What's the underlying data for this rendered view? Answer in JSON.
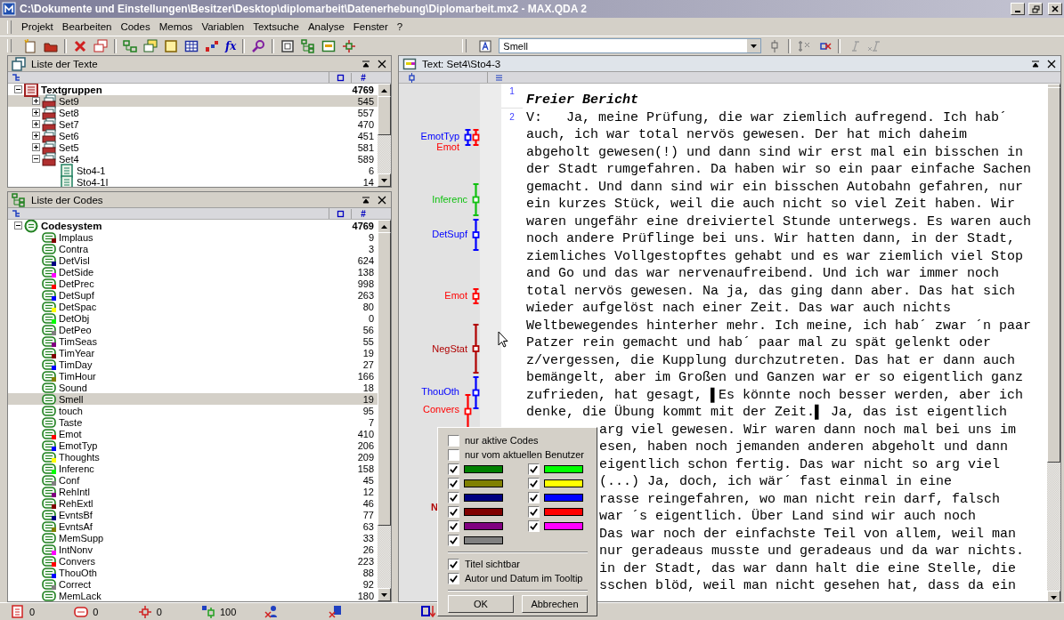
{
  "window": {
    "title": "C:\\Dokumente und Einstellungen\\Besitzer\\Desktop\\diplomarbeit\\Datenerhebung\\Diplomarbeit.mx2 - MAX.QDA 2"
  },
  "menu": [
    "Projekt",
    "Bearbeiten",
    "Codes",
    "Memos",
    "Variablen",
    "Textsuche",
    "Analyse",
    "Fenster",
    "?"
  ],
  "toolbar": {
    "function_button": "fx",
    "code_select": {
      "value": "Smell"
    }
  },
  "texts_panel": {
    "title": "Liste der Texte",
    "count_column": "#",
    "tree": {
      "label": "Textgruppen",
      "count": "4769",
      "expanded": true,
      "selected": false,
      "children": [
        {
          "label": "Set9",
          "count": "545",
          "expanded": false,
          "selected": true
        },
        {
          "label": "Set8",
          "count": "557",
          "expanded": false,
          "selected": false
        },
        {
          "label": "Set7",
          "count": "470",
          "expanded": false,
          "selected": false
        },
        {
          "label": "Set6",
          "count": "451",
          "expanded": false,
          "selected": false
        },
        {
          "label": "Set5",
          "count": "581",
          "expanded": false,
          "selected": false
        },
        {
          "label": "Set4",
          "count": "589",
          "expanded": true,
          "selected": false,
          "children": [
            {
              "label": "Sto4-1",
              "count": "6",
              "selected": false
            },
            {
              "label": "Sto4-1I",
              "count": "14",
              "selected": false
            }
          ]
        }
      ]
    }
  },
  "codes_panel": {
    "title": "Liste der Codes",
    "count_column": "#",
    "tree": {
      "label": "Codesystem",
      "count": "4769",
      "expanded": true,
      "selected": false,
      "children": [
        {
          "label": "Implaus",
          "count": "9",
          "color": "#800000",
          "selected": false
        },
        {
          "label": "Contra",
          "count": "3",
          "selected": false
        },
        {
          "label": "DetVisl",
          "count": "624",
          "color": "#000080",
          "selected": false
        },
        {
          "label": "DetSide",
          "count": "138",
          "color": "#ff00ff",
          "selected": false
        },
        {
          "label": "DetPrec",
          "count": "998",
          "color": "#ff0000",
          "selected": false
        },
        {
          "label": "DetSupf",
          "count": "263",
          "color": "#0000ff",
          "selected": false
        },
        {
          "label": "DetSpac",
          "count": "80",
          "color": "#ffff00",
          "selected": false
        },
        {
          "label": "DetObj",
          "count": "0",
          "color": "#00ff00",
          "selected": false
        },
        {
          "label": "DetPeo",
          "count": "56",
          "color": "#808080",
          "selected": false
        },
        {
          "label": "TimSeas",
          "count": "55",
          "color": "#800080",
          "selected": false
        },
        {
          "label": "TimYear",
          "count": "19",
          "color": "#800000",
          "selected": false
        },
        {
          "label": "TimDay",
          "count": "27",
          "color": "#0000ff",
          "selected": false
        },
        {
          "label": "TimHour",
          "count": "166",
          "color": "#808000",
          "selected": false
        },
        {
          "label": "Sound",
          "count": "18",
          "selected": false
        },
        {
          "label": "Smell",
          "count": "19",
          "selected": true
        },
        {
          "label": "touch",
          "count": "95",
          "selected": false
        },
        {
          "label": "Taste",
          "count": "7",
          "selected": false
        },
        {
          "label": "Emot",
          "count": "410",
          "color": "#ff0000",
          "selected": false
        },
        {
          "label": "EmotTyp",
          "count": "206",
          "color": "#0000ff",
          "selected": false
        },
        {
          "label": "Thoughts",
          "count": "209",
          "color": "#ffff00",
          "selected": false
        },
        {
          "label": "Inferenc",
          "count": "158",
          "color": "#00ff00",
          "selected": false
        },
        {
          "label": "Conf",
          "count": "45",
          "color": "#808080",
          "selected": false
        },
        {
          "label": "RehIntl",
          "count": "12",
          "color": "#800080",
          "selected": false
        },
        {
          "label": "RehExtl",
          "count": "46",
          "color": "#800000",
          "selected": false
        },
        {
          "label": "EvntsBf",
          "count": "77",
          "color": "#000080",
          "selected": false
        },
        {
          "label": "EvntsAf",
          "count": "63",
          "color": "#808000",
          "selected": false
        },
        {
          "label": "MemSupp",
          "count": "33",
          "selected": false
        },
        {
          "label": "IntNonv",
          "count": "26",
          "color": "#ff00ff",
          "selected": false
        },
        {
          "label": "Convers",
          "count": "223",
          "color": "#ff0000",
          "selected": false
        },
        {
          "label": "ThouOth",
          "count": "88",
          "color": "#0000ff",
          "selected": false
        },
        {
          "label": "Correct",
          "count": "92",
          "color": "#808080",
          "selected": false
        },
        {
          "label": "MemLack",
          "count": "180",
          "selected": false
        }
      ]
    }
  },
  "status_bar": {
    "counts": [
      "0",
      "0",
      "0",
      "100"
    ]
  },
  "text_window": {
    "title": "Text: Set4\\Sto4-3",
    "margin_codes": [
      {
        "label": "EmotTyp",
        "color": "#0000ff"
      },
      {
        "label": "Emot",
        "color": "#ff0000"
      },
      {
        "label": "Inferenc",
        "color": "#10c010"
      },
      {
        "label": "DetSupf",
        "color": "#0000ff"
      },
      {
        "label": "Emot",
        "color": "#ff0000"
      },
      {
        "label": "NegStat",
        "color": "#b00000"
      },
      {
        "label": "ThouOth",
        "color": "#0000ff"
      },
      {
        "label": "Convers",
        "color": "#ff0000"
      },
      {
        "label": "N",
        "color": "#b00000"
      }
    ],
    "paragraphs": [
      {
        "number": "1",
        "kind": "title",
        "lines": [
          {
            "text": "Freier Bericht",
            "kind": "full"
          }
        ]
      },
      {
        "number": "2",
        "kind": "body",
        "lines": [
          {
            "text": "V:   Ja, meine Prüfung, die war ziemlich aufregend. Ich hab´",
            "kind": "full"
          },
          {
            "text": "auch, ich war total nervös gewesen. Der hat mich daheim",
            "kind": "full"
          },
          {
            "text": "abgeholt gewesen(!) und dann sind wir erst mal ein bisschen in",
            "kind": "full"
          },
          {
            "text": "der Stadt rumgefahren. Da haben wir so ein paar einfache Sachen",
            "kind": "full"
          },
          {
            "text": "gemacht. Und dann sind wir ein bisschen Autobahn gefahren, nur",
            "kind": "full"
          },
          {
            "text": "ein kurzes Stück, weil die auch nicht so viel Zeit haben. Wir",
            "kind": "full"
          },
          {
            "text": "waren ungefähr eine dreiviertel Stunde unterwegs. Es waren auch",
            "kind": "full"
          },
          {
            "text": "noch andere Prüflinge bei uns. Wir hatten dann, in der Stadt,",
            "kind": "full"
          },
          {
            "text": "ziemliches Vollgestopftes gehabt und es war ziemlich viel Stop",
            "kind": "full"
          },
          {
            "text": "and Go und das war nervenaufreibend. Und ich war immer noch",
            "kind": "full"
          },
          {
            "text": "total nervös gewesen. Na ja, das ging dann aber. Das hat sich",
            "kind": "full"
          },
          {
            "text": "wieder aufgelöst nach einer Zeit. Das war auch nichts",
            "kind": "full"
          },
          {
            "text": "Weltbewegendes hinterher mehr. Ich meine, ich hab´ zwar ´n paar",
            "kind": "full"
          },
          {
            "text": "Patzer rein gemacht und hab´ paar mal zu spät gelenkt oder",
            "kind": "full"
          },
          {
            "text": "z/vergessen, die Kupplung durchzutreten. Das hat er dann auch",
            "kind": "full"
          },
          {
            "text": "bemängelt, aber im Großen und Ganzen war er so eigentlich ganz",
            "kind": "full"
          },
          {
            "text": "zufrieden, hat gesagt, ▌Es könnte noch besser werden, aber ich",
            "kind": "full"
          },
          {
            "text": "denke, die Übung kommt mit der Zeit.▌ Ja, das ist eigentlich",
            "kind": "full"
          },
          {
            "text": "arg viel gewesen. Wir waren dann noch mal bei uns im",
            "kind": "partial"
          },
          {
            "text": "esen, haben noch jemanden anderen abgeholt und dann",
            "kind": "partial"
          },
          {
            "text": "eigentlich schon fertig. Das war nicht so arg viel",
            "kind": "partial"
          },
          {
            "text": "(...) Ja, doch, ich wär´ fast einmal in eine",
            "kind": "partial"
          },
          {
            "text": "rasse reingefahren, wo man nicht rein darf, falsch",
            "kind": "partial"
          },
          {
            "text": "war ´s eigentlich. Über Land sind wir auch noch",
            "kind": "partial"
          },
          {
            "text": "Das war noch der einfachste Teil von allem, weil man",
            "kind": "partial"
          },
          {
            "text": "nur geradeaus musste und geradeaus und da war nichts.",
            "kind": "partial"
          },
          {
            "text": "in der Stadt, das war dann halt die eine Stelle, die",
            "kind": "partial"
          },
          {
            "text": "sschen blöd, weil man nicht gesehen hat, dass da ein",
            "kind": "partial"
          }
        ]
      }
    ]
  },
  "display_options": {
    "options": [
      {
        "label": "nur aktive Codes",
        "checked": false
      },
      {
        "label": "nur vom aktuellen Benutzer",
        "checked": false
      }
    ],
    "colors": [
      {
        "color": "#008000",
        "checked": true
      },
      {
        "color": "#00ff00",
        "checked": true
      },
      {
        "color": "#808000",
        "checked": true
      },
      {
        "color": "#ffff00",
        "checked": true
      },
      {
        "color": "#000080",
        "checked": true
      },
      {
        "color": "#0000ff",
        "checked": true
      },
      {
        "color": "#800000",
        "checked": true
      },
      {
        "color": "#ff0000",
        "checked": true
      },
      {
        "color": "#800080",
        "checked": true
      },
      {
        "color": "#ff00ff",
        "checked": true
      },
      {
        "color": "#808080",
        "checked": true
      }
    ],
    "settings": [
      {
        "label": "Titel sichtbar",
        "checked": true
      },
      {
        "label": "Autor und Datum im Tooltip",
        "checked": true
      }
    ],
    "buttons": [
      "OK",
      "Abbrechen"
    ]
  }
}
